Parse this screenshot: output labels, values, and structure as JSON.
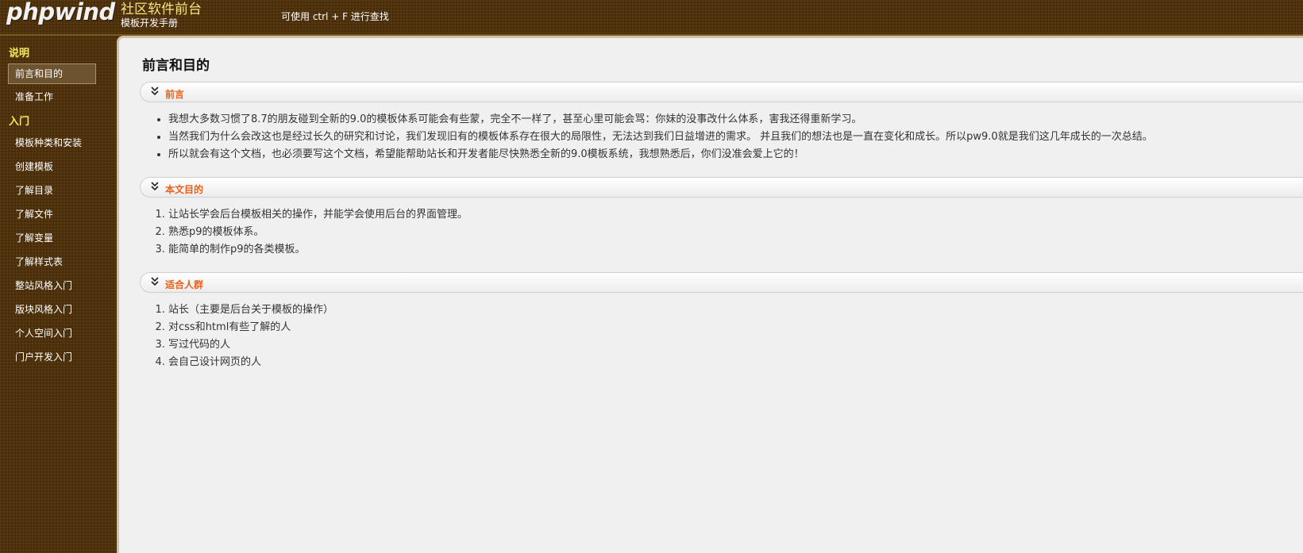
{
  "header": {
    "logo": "phpwind",
    "title": "社区软件前台",
    "subtitle": "模板开发手册",
    "search_hint": "可使用 ctrl + F 进行查找"
  },
  "sidebar": {
    "sections": [
      {
        "label": "说明",
        "items": [
          {
            "label": "前言和目的",
            "active": true
          },
          {
            "label": "准备工作",
            "active": false
          }
        ]
      },
      {
        "label": "入门",
        "items": [
          {
            "label": "模板种类和安装",
            "active": false
          },
          {
            "label": "创建模板",
            "active": false
          },
          {
            "label": "了解目录",
            "active": false
          },
          {
            "label": "了解文件",
            "active": false
          },
          {
            "label": "了解变量",
            "active": false
          },
          {
            "label": "了解样式表",
            "active": false
          },
          {
            "label": "整站风格入门",
            "active": false
          },
          {
            "label": "版块风格入门",
            "active": false
          },
          {
            "label": "个人空间入门",
            "active": false
          },
          {
            "label": "门户开发入门",
            "active": false
          }
        ]
      }
    ]
  },
  "main": {
    "page_title": "前言和目的",
    "sections": [
      {
        "title": "前言",
        "list_type": "bullet",
        "items": [
          "我想大多数习惯了8.7的朋友碰到全新的9.0的模板体系可能会有些蒙，完全不一样了，甚至心里可能会骂：你妹的没事改什么体系，害我还得重新学习。",
          "当然我们为什么会改这也是经过长久的研究和讨论，我们发现旧有的模板体系存在很大的局限性，无法达到我们日益增进的需求。 并且我们的想法也是一直在变化和成长。所以pw9.0就是我们这几年成长的一次总结。",
          "所以就会有这个文档，也必须要写这个文档，希望能帮助站长和开发者能尽快熟悉全新的9.0模板系统，我想熟悉后，你们没准会爱上它的！"
        ]
      },
      {
        "title": "本文目的",
        "list_type": "ordered",
        "items": [
          "让站长学会后台模板相关的操作，并能学会使用后台的界面管理。",
          "熟悉p9的模板体系。",
          "能简单的制作p9的各类模板。"
        ]
      },
      {
        "title": "适合人群",
        "list_type": "ordered",
        "items": [
          "站长（主要是后台关于模板的操作）",
          "对css和html有些了解的人",
          "写过代码的人",
          "会自己设计网页的人"
        ]
      }
    ]
  },
  "colors": {
    "background": "#4e310b",
    "title_yellow": "#f5e37a",
    "section_yellow": "#f5e95a",
    "content_bg": "#f0f0f0",
    "section_title_orange": "#e8621d",
    "text": "#333333"
  },
  "icons": {
    "section_toggle": "double-chevron-down-icon"
  }
}
